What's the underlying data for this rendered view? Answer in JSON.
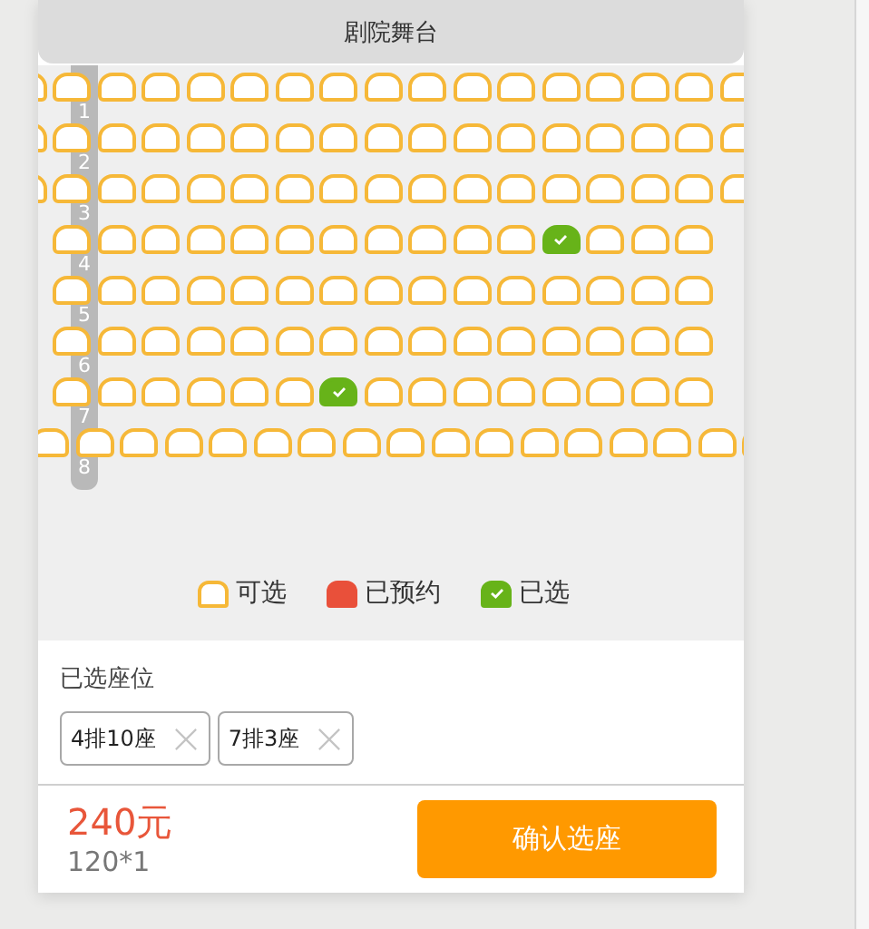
{
  "stage": {
    "title": "剧院舞台"
  },
  "rows": [
    {
      "label": "1",
      "kind": "full",
      "seats": [
        {
          "selected": false
        },
        {
          "selected": false
        },
        {
          "selected": false
        },
        {
          "selected": false
        },
        {
          "selected": false
        },
        {
          "selected": false
        },
        {
          "selected": false
        },
        {
          "selected": false
        },
        {
          "selected": false
        },
        {
          "selected": false
        },
        {
          "selected": false
        },
        {
          "selected": false
        },
        {
          "selected": false
        },
        {
          "selected": false
        },
        {
          "selected": false
        },
        {
          "selected": false
        },
        {
          "selected": false
        }
      ]
    },
    {
      "label": "2",
      "kind": "full",
      "seats": [
        {
          "selected": false
        },
        {
          "selected": false
        },
        {
          "selected": false
        },
        {
          "selected": false
        },
        {
          "selected": false
        },
        {
          "selected": false
        },
        {
          "selected": false
        },
        {
          "selected": false
        },
        {
          "selected": false
        },
        {
          "selected": false
        },
        {
          "selected": false
        },
        {
          "selected": false
        },
        {
          "selected": false
        },
        {
          "selected": false
        },
        {
          "selected": false
        },
        {
          "selected": false
        },
        {
          "selected": false
        }
      ]
    },
    {
      "label": "3",
      "kind": "full",
      "seats": [
        {
          "selected": false
        },
        {
          "selected": false
        },
        {
          "selected": false
        },
        {
          "selected": false
        },
        {
          "selected": false
        },
        {
          "selected": false
        },
        {
          "selected": false
        },
        {
          "selected": false
        },
        {
          "selected": false
        },
        {
          "selected": false
        },
        {
          "selected": false
        },
        {
          "selected": false
        },
        {
          "selected": false
        },
        {
          "selected": false
        },
        {
          "selected": false
        },
        {
          "selected": false
        },
        {
          "selected": false
        }
      ]
    },
    {
      "label": "4",
      "kind": "short",
      "seats": [
        {
          "selected": false
        },
        {
          "selected": false
        },
        {
          "selected": false
        },
        {
          "selected": false
        },
        {
          "selected": false
        },
        {
          "selected": false
        },
        {
          "selected": false
        },
        {
          "selected": false
        },
        {
          "selected": false
        },
        {
          "selected": false
        },
        {
          "selected": false
        },
        {
          "selected": true
        },
        {
          "selected": false
        },
        {
          "selected": false
        },
        {
          "selected": false
        }
      ]
    },
    {
      "label": "5",
      "kind": "short",
      "seats": [
        {
          "selected": false
        },
        {
          "selected": false
        },
        {
          "selected": false
        },
        {
          "selected": false
        },
        {
          "selected": false
        },
        {
          "selected": false
        },
        {
          "selected": false
        },
        {
          "selected": false
        },
        {
          "selected": false
        },
        {
          "selected": false
        },
        {
          "selected": false
        },
        {
          "selected": false
        },
        {
          "selected": false
        },
        {
          "selected": false
        },
        {
          "selected": false
        }
      ]
    },
    {
      "label": "6",
      "kind": "short",
      "seats": [
        {
          "selected": false
        },
        {
          "selected": false
        },
        {
          "selected": false
        },
        {
          "selected": false
        },
        {
          "selected": false
        },
        {
          "selected": false
        },
        {
          "selected": false
        },
        {
          "selected": false
        },
        {
          "selected": false
        },
        {
          "selected": false
        },
        {
          "selected": false
        },
        {
          "selected": false
        },
        {
          "selected": false
        },
        {
          "selected": false
        },
        {
          "selected": false
        }
      ]
    },
    {
      "label": "7",
      "kind": "short",
      "seats": [
        {
          "selected": false
        },
        {
          "selected": false
        },
        {
          "selected": false
        },
        {
          "selected": false
        },
        {
          "selected": false
        },
        {
          "selected": false
        },
        {
          "selected": true
        },
        {
          "selected": false
        },
        {
          "selected": false
        },
        {
          "selected": false
        },
        {
          "selected": false
        },
        {
          "selected": false
        },
        {
          "selected": false
        },
        {
          "selected": false
        },
        {
          "selected": false
        }
      ]
    },
    {
      "label": "8",
      "kind": "offset",
      "seats": [
        {
          "selected": false
        },
        {
          "selected": false
        },
        {
          "selected": false
        },
        {
          "selected": false
        },
        {
          "selected": false
        },
        {
          "selected": false
        },
        {
          "selected": false
        },
        {
          "selected": false
        },
        {
          "selected": false
        },
        {
          "selected": false
        },
        {
          "selected": false
        },
        {
          "selected": false
        },
        {
          "selected": false
        },
        {
          "selected": false
        },
        {
          "selected": false
        },
        {
          "selected": false
        },
        {
          "selected": false
        }
      ]
    }
  ],
  "legend": [
    {
      "kind": "available",
      "label": "可选"
    },
    {
      "kind": "reserved",
      "label": "已预约"
    },
    {
      "kind": "selected",
      "label": "已选"
    }
  ],
  "chosen": {
    "title": "已选座位",
    "tags": [
      {
        "label": "4排10座"
      },
      {
        "label": "7排3座"
      }
    ]
  },
  "footer": {
    "total": "240元",
    "detail": "120*1",
    "button": "确认选座"
  }
}
